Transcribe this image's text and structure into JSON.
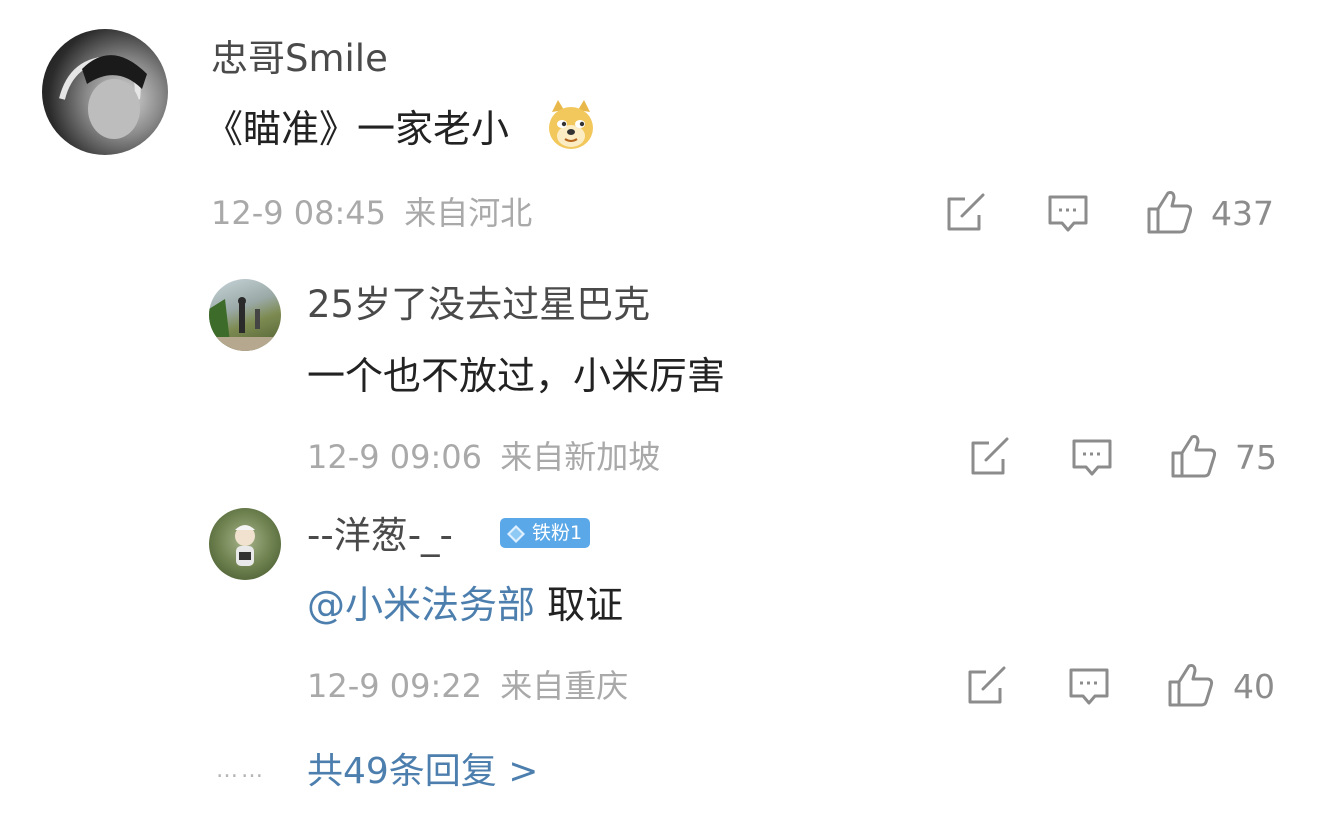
{
  "main_comment": {
    "author": "忠哥Smile",
    "text": "《瞄准》一家老小",
    "emoji": "doge-emoji",
    "time": "12-9 08:45",
    "location": "来自河北",
    "likes": "437"
  },
  "replies": [
    {
      "author": "25岁了没去过星巴克",
      "text": "一个也不放过，小米厉害",
      "time": "12-9 09:06",
      "location": "来自新加坡",
      "likes": "75"
    },
    {
      "author": "--洋葱-_-",
      "badge": "铁粉1",
      "mention": "@小米法务部",
      "text": " 取证",
      "time": "12-9 09:22",
      "location": "来自重庆",
      "likes": "40"
    }
  ],
  "more_replies": {
    "dots": "……",
    "label": "共49条回复 >"
  },
  "icons": [
    "share-icon",
    "comment-icon",
    "like-icon"
  ],
  "colors": {
    "link": "#4d7fae",
    "meta_text": "#a9a9a9",
    "badge": "#5aa8e8"
  }
}
